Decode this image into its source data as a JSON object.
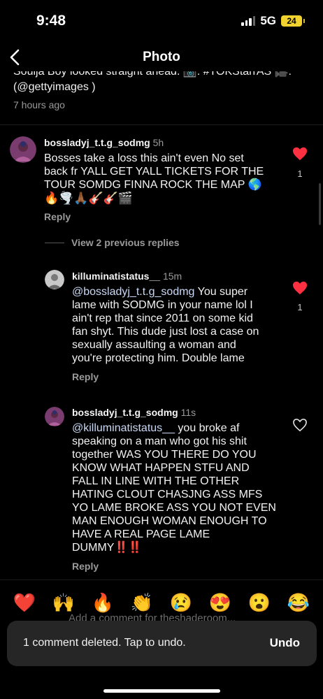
{
  "status_bar": {
    "time": "9:48",
    "network": "5G",
    "battery": "24"
  },
  "nav": {
    "title": "Photo"
  },
  "caption": {
    "line1": "Soulja Boy looked straight ahead. 📸: #TOKStarrAS 🎥:",
    "line2": "(@gettyimages )",
    "time": "7 hours ago"
  },
  "comments": [
    {
      "username": "bossladyj_t.t.g_sodmg",
      "time": "5h",
      "text_lines": [
        "Bosses take a loss this ain't even No set",
        "back fr YALL GET YALL TICKETS FOR THE",
        "TOUR SOMDG FINNA ROCK THE MAP 🌎",
        "🔥🌪️🙏🏾🎸🎸🎬"
      ],
      "reply_label": "Reply",
      "likes": "1"
    }
  ],
  "view_replies": "View 2 previous replies",
  "replies": [
    {
      "username": "killuminatistatus__",
      "time": "15m",
      "mention": "@bossladyj_t.t.g_sodmg",
      "text_lines": [
        " You super",
        "lame with SODMG in your name lol I",
        "ain't rep that since 2011 on some kid",
        "fan shyt. This dude just lost a case on",
        "sexually assaulting a woman and",
        "you're protecting him. Double lame"
      ],
      "reply_label": "Reply",
      "likes": "1"
    },
    {
      "username": "bossladyj_t.t.g_sodmg",
      "time": "11s",
      "mention": "@killuminatistatus__",
      "text_lines": [
        " you broke af",
        "speaking on a man who got his shit",
        "together WAS YOU THERE DO YOU",
        "KNOW WHAT HAPPEN STFU AND",
        "FALL IN LINE WITH THE OTHER",
        "HATING CLOUT CHASJNG ASS MFS",
        "YO LAME BROKE ASS YOU NOT EVEN",
        "MAN ENOUGH WOMAN ENOUGH TO",
        "HAVE A REAL PAGE LAME",
        "DUMMY‼️‼️"
      ],
      "reply_label": "Reply"
    }
  ],
  "emoji_bar": [
    "❤️",
    "🙌",
    "🔥",
    "👏",
    "😢",
    "😍",
    "😮",
    "😂"
  ],
  "add_comment_placeholder": "Add a comment for theshaderoom...",
  "toast": {
    "message": "1 comment deleted. Tap to undo.",
    "action": "Undo"
  },
  "colors": {
    "like_red": "#ff3040",
    "mention": "#c9d8f5",
    "toast_bg": "#262626"
  }
}
